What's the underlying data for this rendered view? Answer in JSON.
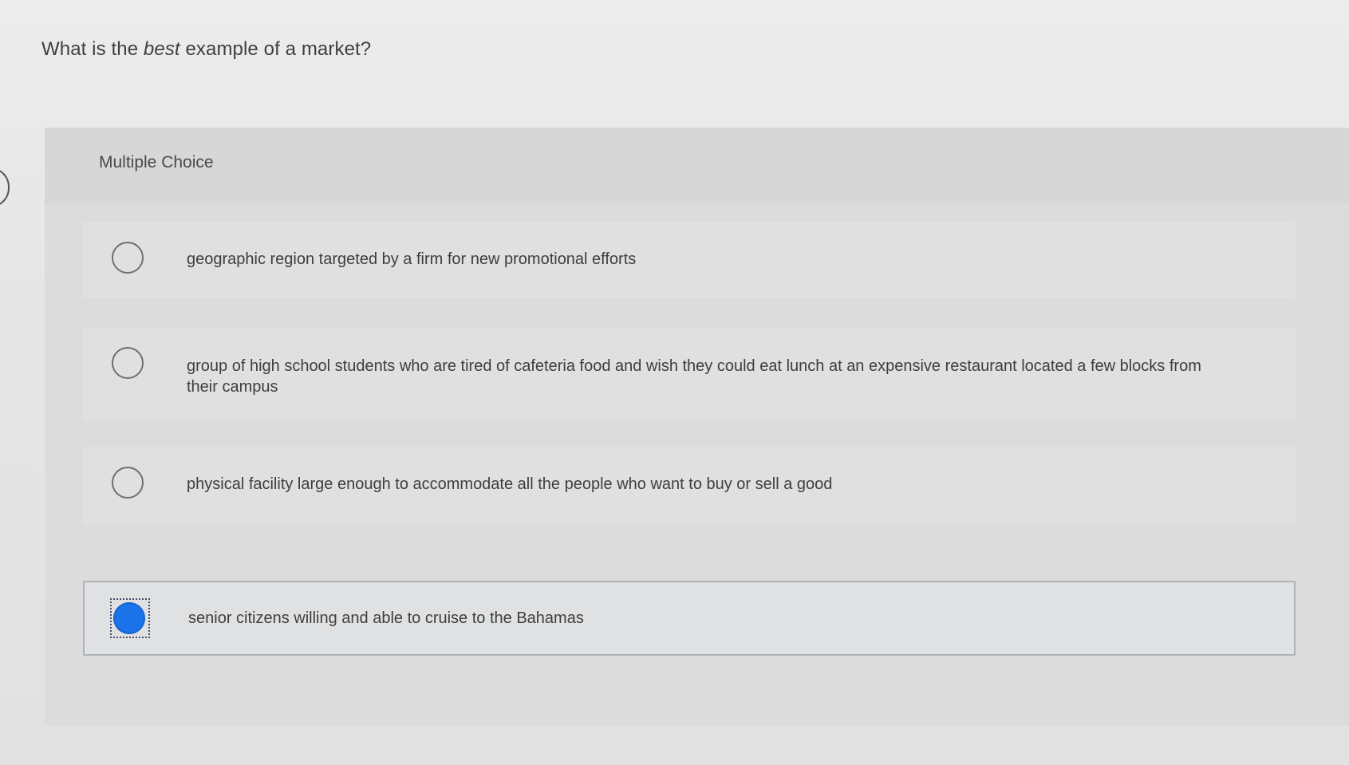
{
  "question": {
    "prefix": "What is the ",
    "emphasis": "best",
    "suffix": " example of a market?"
  },
  "section_label": "Multiple Choice",
  "options": [
    {
      "text": "geographic region targeted by a firm for new promotional efforts",
      "selected": false
    },
    {
      "text": "group of high school students who are tired of cafeteria food and wish they could eat lunch at an expensive restaurant located a few blocks from their campus",
      "selected": false
    },
    {
      "text": "physical facility large enough to accommodate all the people who want to buy or sell a good",
      "selected": false
    },
    {
      "text": "senior citizens willing and able to cruise to the Bahamas",
      "selected": true
    }
  ],
  "colors": {
    "selected_radio": "#1a73e8",
    "selected_border": "#aeb3b8"
  }
}
